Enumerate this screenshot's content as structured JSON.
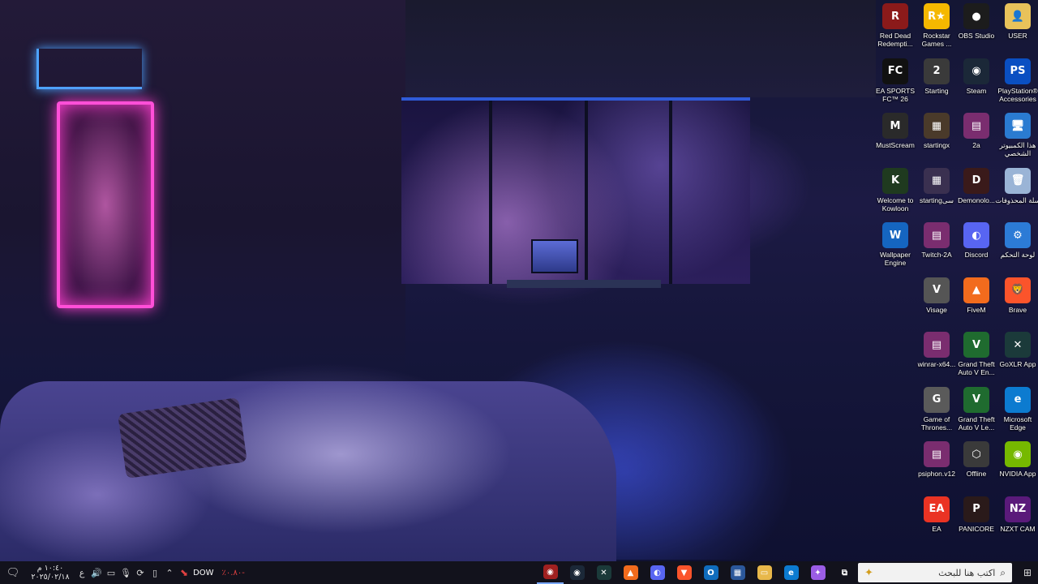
{
  "desktop_icons": [
    {
      "label": "Red Dead Redempti...",
      "icon": "red-dead-icon",
      "color": "#8b1a1a",
      "glyph": "R"
    },
    {
      "label": "Rockstar Games ...",
      "icon": "rockstar-icon",
      "color": "#f5b800",
      "glyph": "R★"
    },
    {
      "label": "OBS Studio",
      "icon": "obs-icon",
      "color": "#1c1c1c",
      "glyph": "●"
    },
    {
      "label": "USER",
      "icon": "user-folder-icon",
      "color": "#e8c25a",
      "glyph": "👤"
    },
    {
      "label": "EA SPORTS FC™ 26",
      "icon": "ea-fc-icon",
      "color": "#111111",
      "glyph": "FC"
    },
    {
      "label": "Starting",
      "icon": "starting-icon",
      "color": "#3a3a3a",
      "glyph": "2"
    },
    {
      "label": "Steam",
      "icon": "steam-icon",
      "color": "#1b2838",
      "glyph": "◉"
    },
    {
      "label": "PlayStation® Accessories",
      "icon": "playstation-icon",
      "color": "#0a4fc2",
      "glyph": "PS"
    },
    {
      "label": "MustScream",
      "icon": "mustscream-icon",
      "color": "#2a2a2a",
      "glyph": "M"
    },
    {
      "label": "startingx",
      "icon": "startingx-icon",
      "color": "#4a3a2a",
      "glyph": "▦"
    },
    {
      "label": "2a",
      "icon": "winrar-archive-icon",
      "color": "#7a2d6f",
      "glyph": "▤"
    },
    {
      "label": "هذا الكمبيوتر الشخصي",
      "icon": "this-pc-icon",
      "color": "#2a7bd1",
      "glyph": "🖥"
    },
    {
      "label": "Welcome to Kowloon",
      "icon": "kowloon-icon",
      "color": "#1f3a1f",
      "glyph": "K"
    },
    {
      "label": "startingسی",
      "icon": "starting-arabic-icon",
      "color": "#3a3050",
      "glyph": "▦"
    },
    {
      "label": "Demonolo...",
      "icon": "demonologist-icon",
      "color": "#3a1a1a",
      "glyph": "D"
    },
    {
      "label": "سلة المحذوفات",
      "icon": "recycle-bin-icon",
      "color": "#9ab4d6",
      "glyph": "🗑"
    },
    {
      "label": "Wallpaper Engine",
      "icon": "wallpaper-engine-icon",
      "color": "#1565c0",
      "glyph": "W"
    },
    {
      "label": "Twitch-2A",
      "icon": "twitch-archive-icon",
      "color": "#7a2d6f",
      "glyph": "▤"
    },
    {
      "label": "Discord",
      "icon": "discord-icon",
      "color": "#5865f2",
      "glyph": "◐"
    },
    {
      "label": "لوحة التحكم",
      "icon": "control-panel-icon",
      "color": "#2c7bd6",
      "glyph": "⚙"
    },
    {
      "label": "",
      "icon": "",
      "color": "",
      "glyph": ""
    },
    {
      "label": "Visage",
      "icon": "visage-icon",
      "color": "#555555",
      "glyph": "V"
    },
    {
      "label": "FiveM",
      "icon": "fivem-icon",
      "color": "#f26b1d",
      "glyph": "▲"
    },
    {
      "label": "Brave",
      "icon": "brave-icon",
      "color": "#fb542b",
      "glyph": "🦁"
    },
    {
      "label": "",
      "icon": "",
      "color": "",
      "glyph": ""
    },
    {
      "label": "winrar-x64...",
      "icon": "winrar-installer-icon",
      "color": "#7a2d6f",
      "glyph": "▤"
    },
    {
      "label": "Grand Theft Auto V En...",
      "icon": "gta-v-enhanced-icon",
      "color": "#1f6b2f",
      "glyph": "V"
    },
    {
      "label": "GoXLR App",
      "icon": "goxlr-icon",
      "color": "#1b3a3a",
      "glyph": "✕"
    },
    {
      "label": "",
      "icon": "",
      "color": "",
      "glyph": ""
    },
    {
      "label": "Game of Thrones...",
      "icon": "game-of-thrones-icon",
      "color": "#5a5a5a",
      "glyph": "G"
    },
    {
      "label": "Grand Theft Auto V Le...",
      "icon": "gta-v-legacy-icon",
      "color": "#1f6b2f",
      "glyph": "V"
    },
    {
      "label": "Microsoft Edge",
      "icon": "edge-icon",
      "color": "#0c7bd0",
      "glyph": "e"
    },
    {
      "label": "",
      "icon": "",
      "color": "",
      "glyph": ""
    },
    {
      "label": "psiphon.v12",
      "icon": "psiphon-icon",
      "color": "#7a2d6f",
      "glyph": "▤"
    },
    {
      "label": "Offline",
      "icon": "offline-icon",
      "color": "#3a3a3a",
      "glyph": "⬡"
    },
    {
      "label": "NVIDIA App",
      "icon": "nvidia-icon",
      "color": "#76b900",
      "glyph": "◉"
    },
    {
      "label": "",
      "icon": "",
      "color": "",
      "glyph": ""
    },
    {
      "label": "EA",
      "icon": "ea-icon",
      "color": "#ea3323",
      "glyph": "EA"
    },
    {
      "label": "PANICORE",
      "icon": "panicore-icon",
      "color": "#2a1a1a",
      "glyph": "P"
    },
    {
      "label": "NZXT CAM",
      "icon": "nzxt-cam-icon",
      "color": "#5a1a7a",
      "glyph": "NZ"
    }
  ],
  "taskbar": {
    "clock_time": "١٠:٤٠ م",
    "clock_date": "٢٠٢٥/٠٢/١٨",
    "language": "ع",
    "notification_icon": "notification-icon",
    "tray_app_label": "DOW",
    "tray_app_value": "٪٠.٨٠-",
    "search_placeholder": "اكتب هنا للبحث",
    "pinned_apps": [
      {
        "icon": "mustscream-taskbar-icon",
        "color": "#a02020",
        "glyph": "◉"
      },
      {
        "icon": "steam-taskbar-icon",
        "color": "#1b2838",
        "glyph": "◉"
      },
      {
        "icon": "goxlr-taskbar-icon",
        "color": "#1b3a3a",
        "glyph": "✕"
      },
      {
        "icon": "fivem-taskbar-icon",
        "color": "#f26b1d",
        "glyph": "▲"
      },
      {
        "icon": "discord-taskbar-icon",
        "color": "#5865f2",
        "glyph": "◐"
      },
      {
        "icon": "brave-taskbar-icon",
        "color": "#fb542b",
        "glyph": "▼"
      },
      {
        "icon": "outlook-taskbar-icon",
        "color": "#0f6cbd",
        "glyph": "O"
      },
      {
        "icon": "store-taskbar-icon",
        "color": "#2b579a",
        "glyph": "▦"
      },
      {
        "icon": "file-explorer-taskbar-icon",
        "color": "#e8b84a",
        "glyph": "▭"
      },
      {
        "icon": "edge-taskbar-icon",
        "color": "#0c7bd0",
        "glyph": "e"
      },
      {
        "icon": "copilot-taskbar-icon",
        "color": "#9b5de5",
        "glyph": "✦"
      },
      {
        "icon": "task-view-taskbar-icon",
        "color": "#12121c",
        "glyph": "⧉"
      }
    ]
  }
}
